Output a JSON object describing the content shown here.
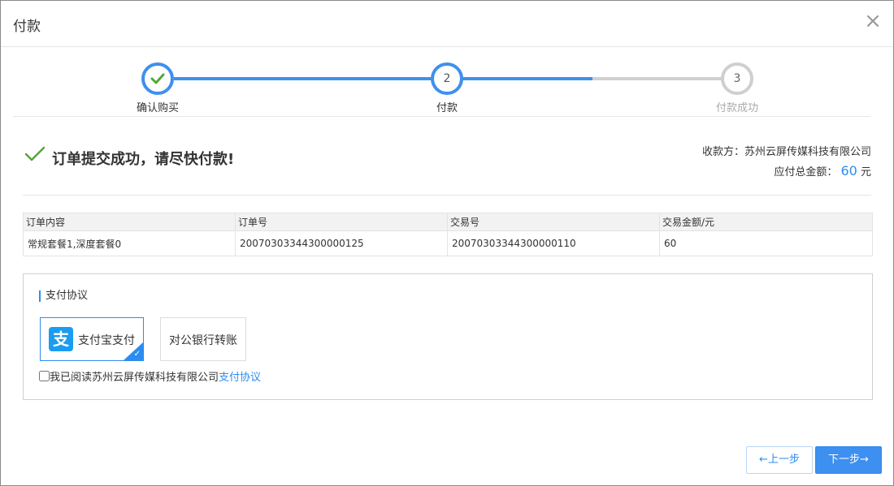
{
  "dialog": {
    "title": "付款",
    "close_label": "×"
  },
  "steps": [
    {
      "number": "",
      "label": "确认购买",
      "state": "done"
    },
    {
      "number": "2",
      "label": "付款",
      "state": "active"
    },
    {
      "number": "3",
      "label": "付款成功",
      "state": "pending"
    }
  ],
  "status": {
    "message": "订单提交成功，请尽快付款!",
    "payee_label": "收款方：",
    "payee_name": "苏州云屏传媒科技有限公司",
    "total_label": "应付总金额：",
    "total_amount": "60",
    "total_unit": "元"
  },
  "order_table": {
    "headers": [
      "订单内容",
      "订单号",
      "交易号",
      "交易金额/元"
    ],
    "rows": [
      [
        "常规套餐1,深度套餐0",
        "20070303344300000125",
        "20070303344300000110",
        "60"
      ]
    ]
  },
  "payment": {
    "section_title": "支付协议",
    "options": [
      {
        "label": "支付宝支付",
        "logo_glyph": "支",
        "selected": true
      },
      {
        "label": "对公银行转账",
        "selected": false
      }
    ],
    "agree_text": "我已阅读苏州云屏传媒科技有限公司",
    "agree_link": "支付协议"
  },
  "buttons": {
    "prev": "←上一步",
    "next": "下一步→"
  },
  "colors": {
    "accent": "#2d8cf0",
    "success": "#52a83a",
    "pending": "#cfcfcf"
  }
}
